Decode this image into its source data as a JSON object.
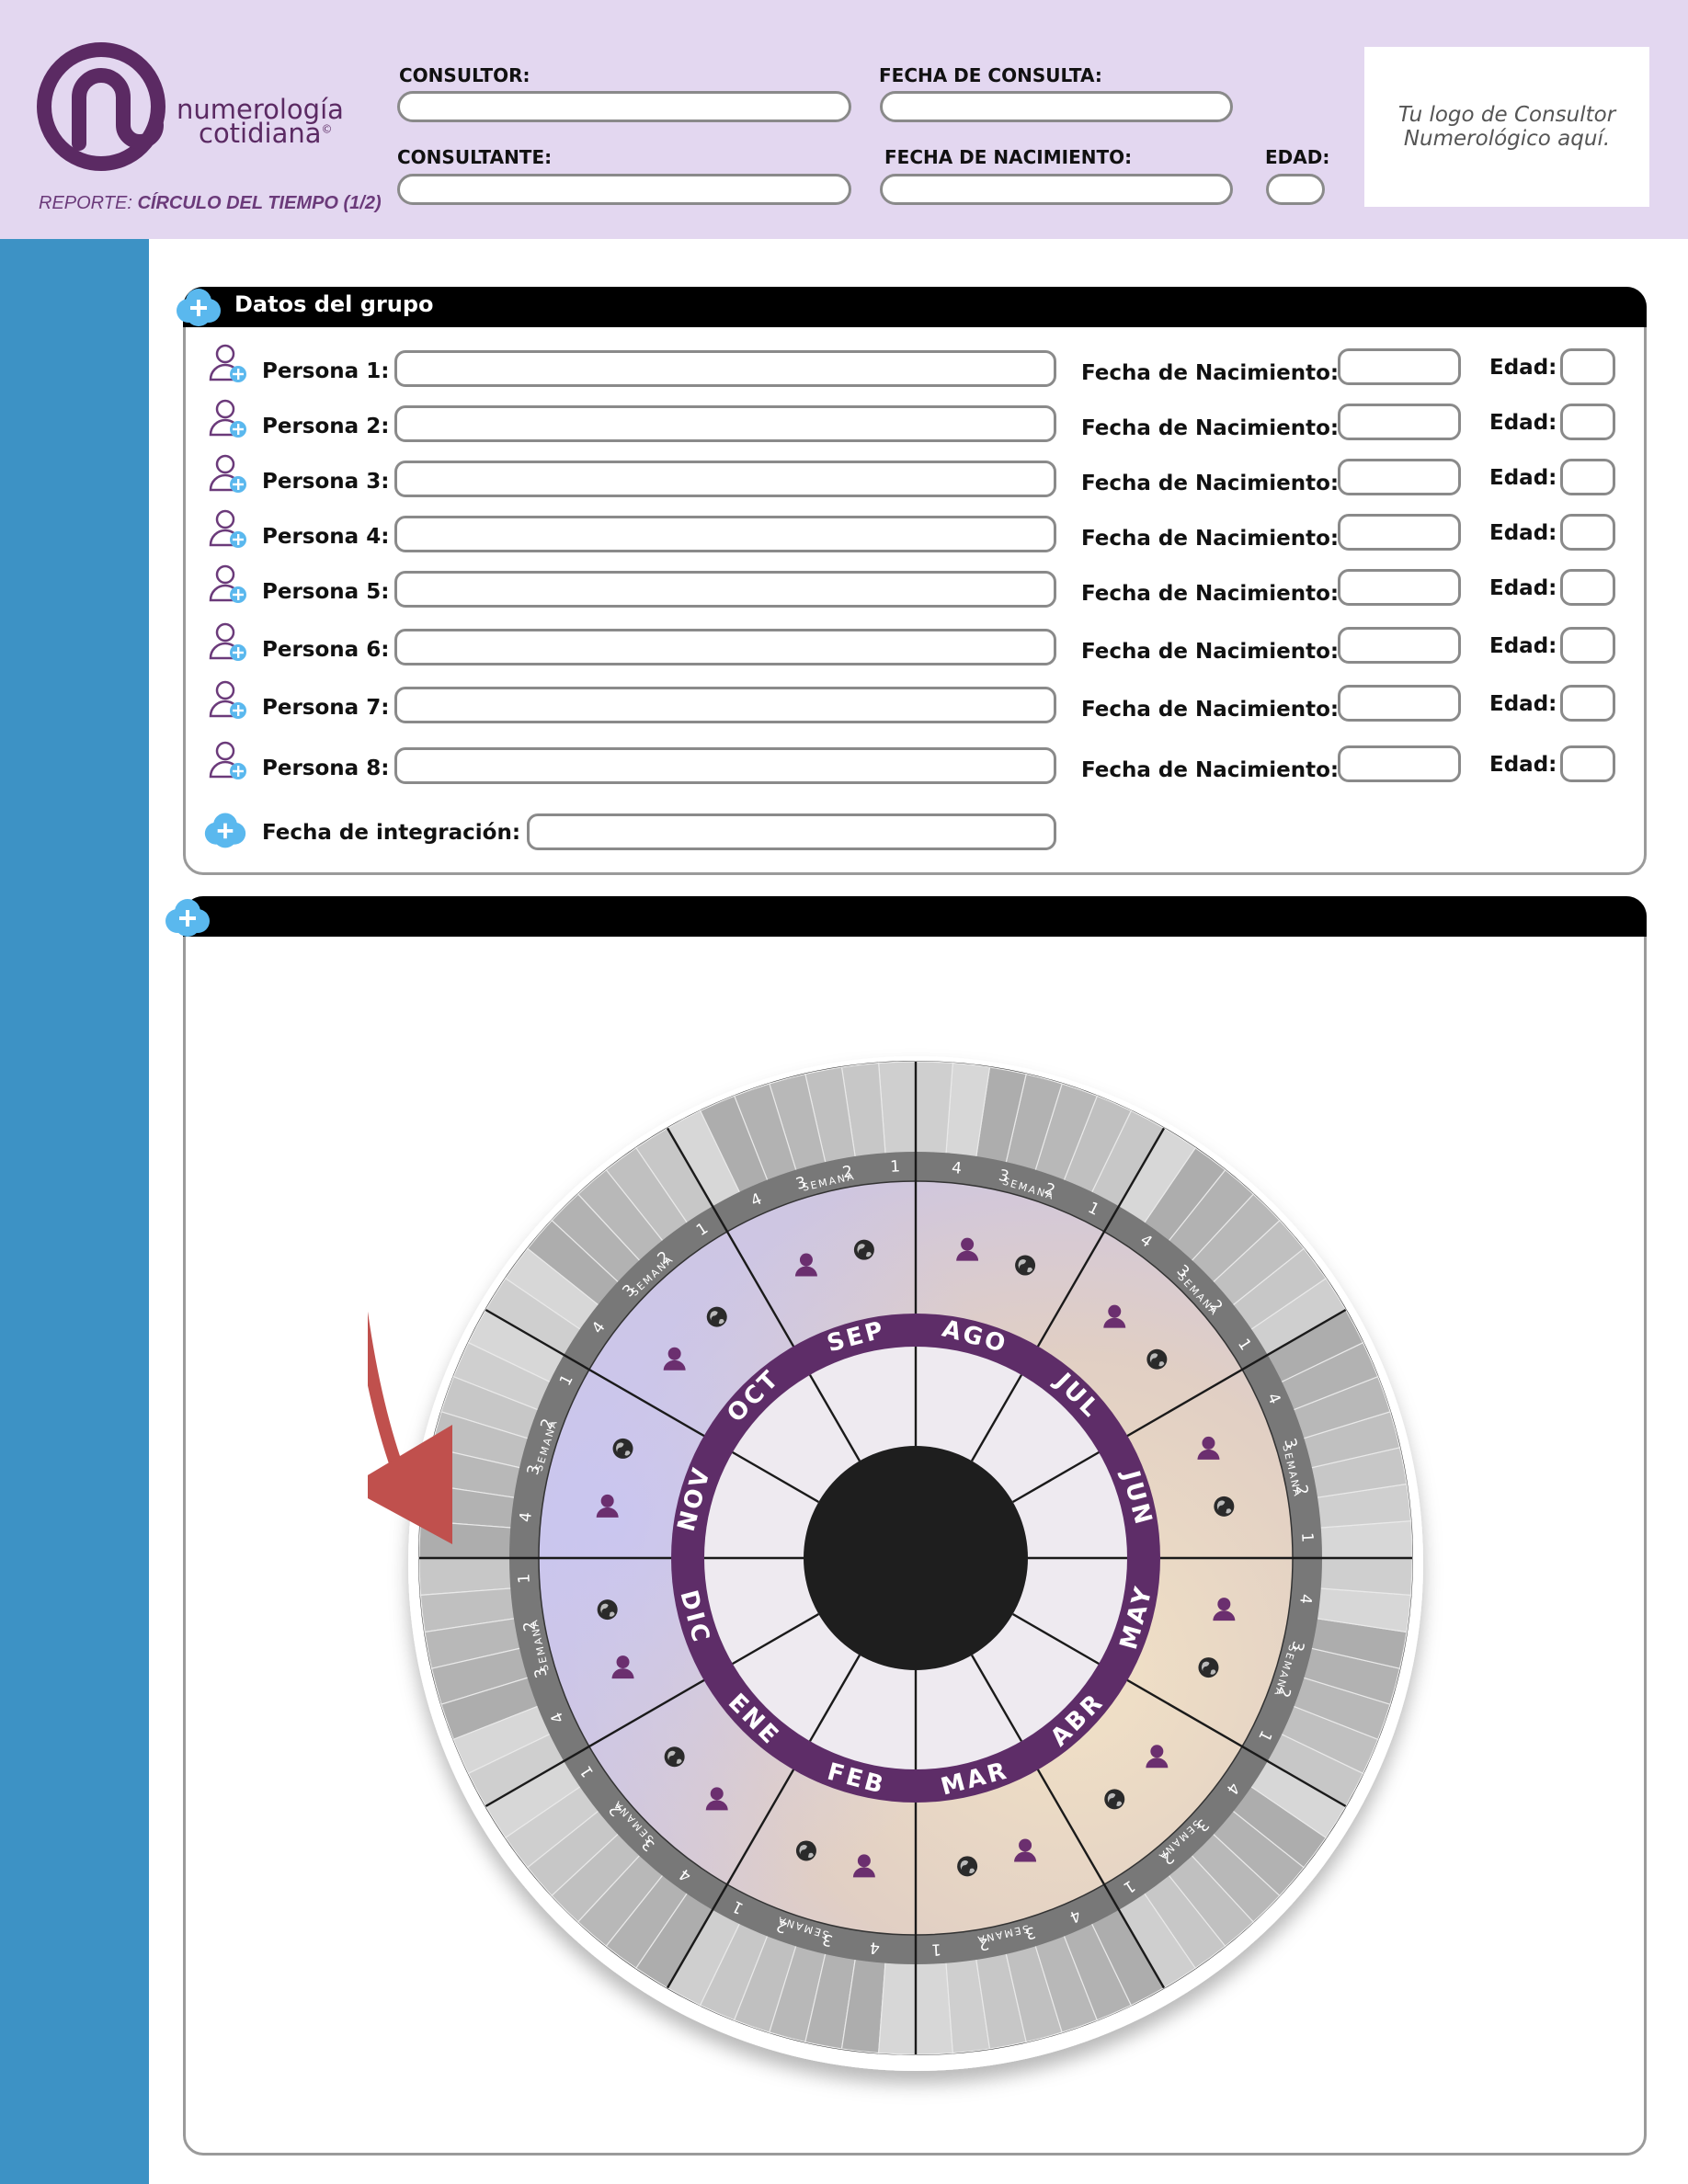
{
  "header": {
    "brand_line1": "numerología",
    "brand_line2": "cotidiana",
    "brand_mark": "©",
    "report_prefix": "REPORTE:",
    "report_name": "CÍRCULO DEL TIEMPO (1/2)",
    "consultor_label": "CONSULTOR:",
    "fecha_consulta_label": "FECHA DE CONSULTA:",
    "consultante_label": "CONSULTANTE:",
    "fecha_nacimiento_label": "FECHA DE NACIMIENTO:",
    "edad_label": "EDAD:",
    "logo_placeholder_line1": "Tu logo de Consultor",
    "logo_placeholder_line2": "Numerológico aquí."
  },
  "colors": {
    "header_bg": "#e3d7f0",
    "sidebar": "#3d92c5",
    "brand_purple": "#5b2a63",
    "month_ring": "#5e2d68",
    "arrow": "#c0504d",
    "badge_blue": "#5ab8ee"
  },
  "group": {
    "title": "Datos del grupo",
    "birth_label": "Fecha de Nacimiento:",
    "age_label": "Edad:",
    "persons": [
      {
        "label": "Persona 1:"
      },
      {
        "label": "Persona 2:"
      },
      {
        "label": "Persona 3:"
      },
      {
        "label": "Persona 4:"
      },
      {
        "label": "Persona 5:"
      },
      {
        "label": "Persona 6:"
      },
      {
        "label": "Persona 7:"
      },
      {
        "label": "Persona 8:"
      }
    ],
    "integration_label": "Fecha de integración:"
  },
  "wheel": {
    "months": [
      "JUN",
      "JUL",
      "AGO",
      "SEP",
      "OCT",
      "NOV",
      "DIC",
      "ENE",
      "FEB",
      "MAR",
      "ABR",
      "MAY"
    ],
    "week_word": "SEMANA",
    "week_numbers": [
      "1",
      "2",
      "3",
      "4"
    ],
    "person_icon": "person-icon",
    "world_icon": "globe-icon",
    "direction_icon": "rotation-arrow-icon"
  }
}
